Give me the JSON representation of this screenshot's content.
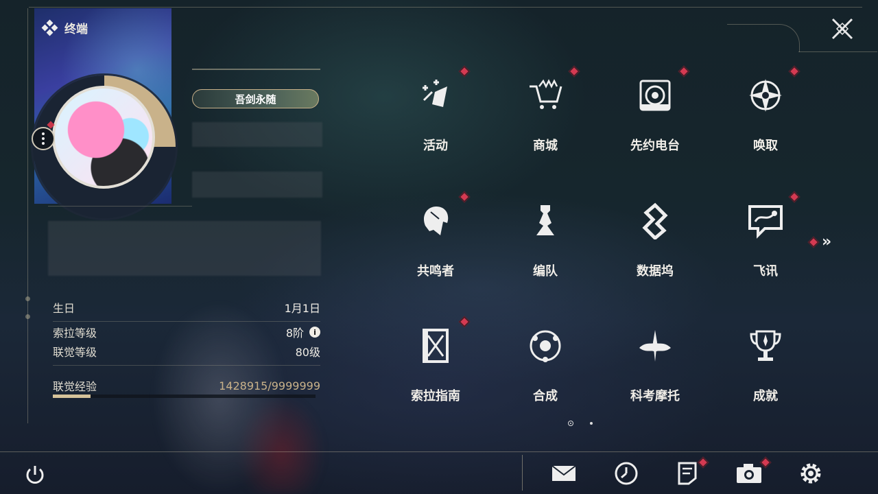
{
  "title": "终端",
  "profile": {
    "title_badge": "吾剑永随"
  },
  "stats": {
    "birthday_label": "生日",
    "birthday_value": "1月1日",
    "sola_level_label": "索拉等级",
    "sola_level_value": "8阶",
    "union_level_label": "联觉等级",
    "union_level_value": "80级",
    "union_exp_label": "联觉经验",
    "union_exp_value": "1428915/9999999",
    "union_exp_progress": 0.143
  },
  "menu": {
    "items": [
      {
        "label": "活动",
        "icon": "sparkle-star-icon",
        "alert": true
      },
      {
        "label": "商城",
        "icon": "shopping-cart-icon",
        "alert": true
      },
      {
        "label": "先约电台",
        "icon": "speaker-icon",
        "alert": true
      },
      {
        "label": "唤取",
        "icon": "compass-icon",
        "alert": true
      },
      {
        "label": "共鸣者",
        "icon": "character-head-icon",
        "alert": true
      },
      {
        "label": "编队",
        "icon": "chess-piece-icon",
        "alert": false
      },
      {
        "label": "数据坞",
        "icon": "data-dock-icon",
        "alert": false
      },
      {
        "label": "飞讯",
        "icon": "message-bubble-icon",
        "alert": true
      },
      {
        "label": "索拉指南",
        "icon": "guide-book-icon",
        "alert": true
      },
      {
        "label": "合成",
        "icon": "synthesis-icon",
        "alert": false
      },
      {
        "label": "科考摩托",
        "icon": "motorcycle-icon",
        "alert": false
      },
      {
        "label": "成就",
        "icon": "trophy-icon",
        "alert": false
      }
    ],
    "page_count": 2,
    "current_page": 1
  },
  "bottom_bar": {
    "icons": [
      "power-icon",
      "mail-icon",
      "clock-icon",
      "notice-icon",
      "camera-icon",
      "settings-icon"
    ]
  },
  "colors": {
    "accent_gold": "#c9b28a",
    "alert_red": "#d43a52"
  }
}
